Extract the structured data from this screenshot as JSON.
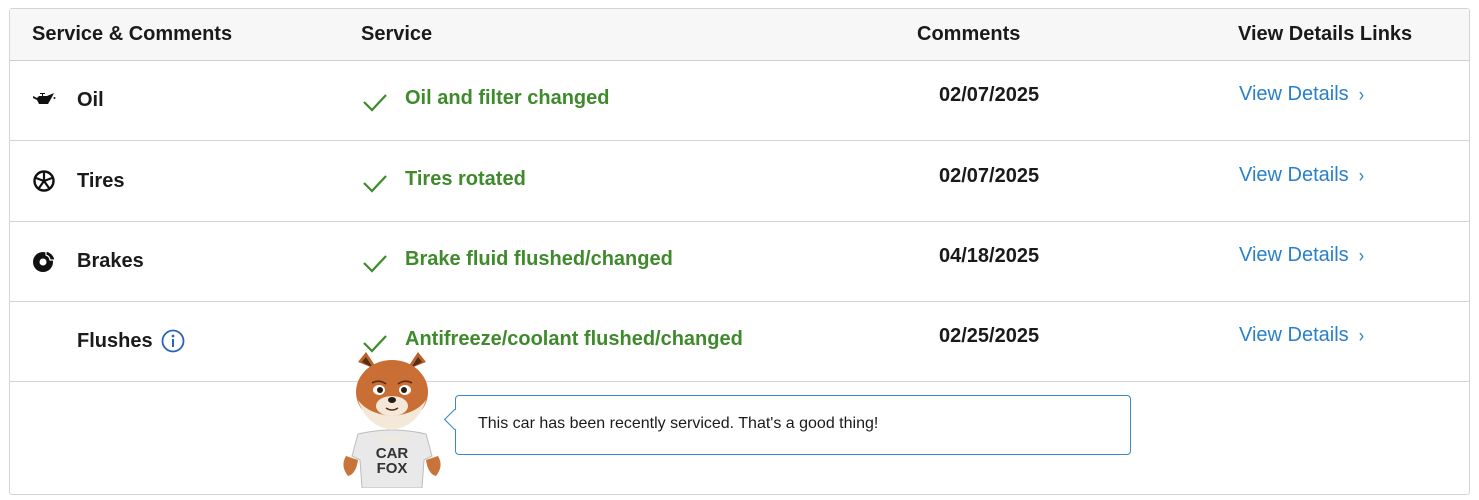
{
  "headers": {
    "category": "Service & Comments",
    "service": "Service",
    "comments": "Comments",
    "links": "View Details Links"
  },
  "rows": [
    {
      "category": "Oil",
      "icon": "oil-can-icon",
      "service": "Oil and filter changed",
      "date": "02/07/2025",
      "link": "View Details"
    },
    {
      "category": "Tires",
      "icon": "tire-icon",
      "service": "Tires rotated",
      "date": "02/07/2025",
      "link": "View Details"
    },
    {
      "category": "Brakes",
      "icon": "brake-disc-icon",
      "service": "Brake fluid flushed/changed",
      "date": "04/18/2025",
      "link": "View Details"
    },
    {
      "category": "Flushes",
      "icon": "info-icon",
      "service": "Antifreeze/coolant flushed/changed",
      "date": "02/25/2025",
      "link": "View Details"
    }
  ],
  "mascot": {
    "shirt_text": "CAR FOX"
  },
  "message": "This car has been recently serviced. That's a good thing!",
  "colors": {
    "success_green": "#3f8a2c",
    "link_blue": "#2a7fc9",
    "bubble_border": "#3a86c8"
  }
}
